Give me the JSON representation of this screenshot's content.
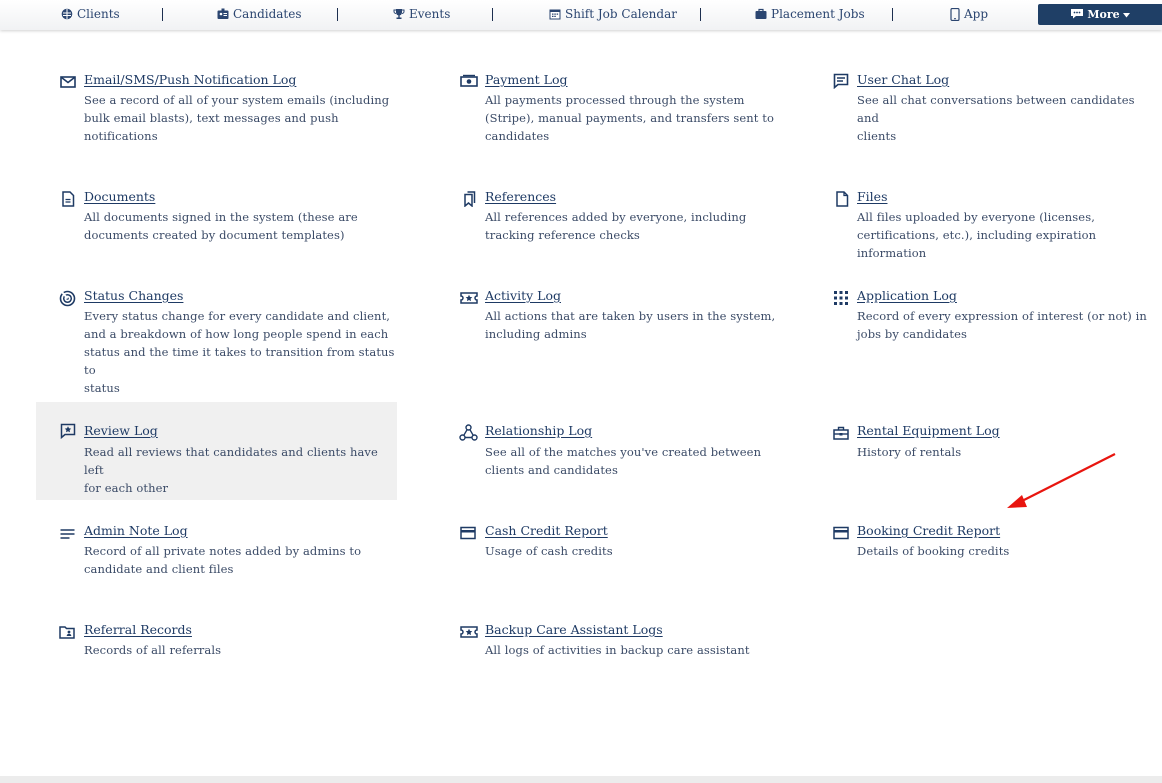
{
  "nav": {
    "items": [
      {
        "label": "Clients",
        "icon": "globe-icon"
      },
      {
        "label": "Candidates",
        "icon": "id-badge-icon"
      },
      {
        "label": "Events",
        "icon": "trophy-icon"
      },
      {
        "label": "Shift Job Calendar",
        "icon": "calendar-icon"
      },
      {
        "label": "Placement Jobs",
        "icon": "briefcase-icon"
      },
      {
        "label": "App",
        "icon": "phone-icon"
      }
    ],
    "more_label": "More",
    "accent_color": "#1f3f66"
  },
  "cards": [
    {
      "title": "Email/SMS/Push Notification Log",
      "desc": [
        "See a record of all of your system emails (including",
        "bulk email blasts), text messages and push",
        "notifications"
      ],
      "icon": "envelope-icon"
    },
    {
      "title": "Payment Log",
      "desc": [
        "All payments processed through the system",
        "(Stripe), manual payments, and transfers sent to",
        "candidates"
      ],
      "icon": "money-icon"
    },
    {
      "title": "User Chat Log",
      "desc": [
        "See all chat conversations between candidates and",
        "clients"
      ],
      "icon": "chat-icon"
    },
    {
      "title": "Documents",
      "desc": [
        "All documents signed in the system (these are",
        "documents created by document templates)"
      ],
      "icon": "document-icon"
    },
    {
      "title": "References",
      "desc": [
        "All references added by everyone, including",
        "tracking reference checks"
      ],
      "icon": "bookmarks-icon"
    },
    {
      "title": "Files",
      "desc": [
        "All files uploaded by everyone (licenses,",
        "certifications, etc.), including expiration information"
      ],
      "icon": "file-icon"
    },
    {
      "title": "Status Changes",
      "desc": [
        "Every status change for every candidate and client,",
        "and a breakdown of how long people spend in each",
        "status and the time it takes to transition from status to",
        "status"
      ],
      "icon": "radar-icon"
    },
    {
      "title": "Activity Log",
      "desc": [
        "All actions that are taken by users in the system,",
        "including admins"
      ],
      "icon": "ticket-star-icon"
    },
    {
      "title": "Application Log",
      "desc": [
        "Record of every expression of interest (or not) in",
        "jobs by candidates"
      ],
      "icon": "grid-dots-icon"
    },
    {
      "title": "Review Log",
      "desc": [
        "Read all reviews that candidates and clients have left",
        "for each other"
      ],
      "icon": "review-star-icon"
    },
    {
      "title": "Relationship Log",
      "desc": [
        "See all of the matches you've created between",
        "clients and candidates"
      ],
      "icon": "relationship-icon"
    },
    {
      "title": "Rental Equipment Log",
      "desc": [
        "History of rentals"
      ],
      "icon": "toolbox-icon"
    },
    {
      "title": "Admin Note Log",
      "desc": [
        "Record of all private notes added by admins to",
        "candidate and client files"
      ],
      "icon": "notes-lines-icon"
    },
    {
      "title": "Cash Credit Report",
      "desc": [
        "Usage of cash credits"
      ],
      "icon": "credit-card-icon"
    },
    {
      "title": "Booking Credit Report",
      "desc": [
        "Details of booking credits"
      ],
      "icon": "credit-card-icon"
    },
    {
      "title": "Referral Records",
      "desc": [
        "Records of all referrals"
      ],
      "icon": "folder-person-icon"
    },
    {
      "title": "Backup Care Assistant Logs",
      "desc": [
        "All logs of activities in backup care assistant"
      ],
      "icon": "ticket-star-icon"
    }
  ],
  "annotation_arrow_color": "#e8150f"
}
